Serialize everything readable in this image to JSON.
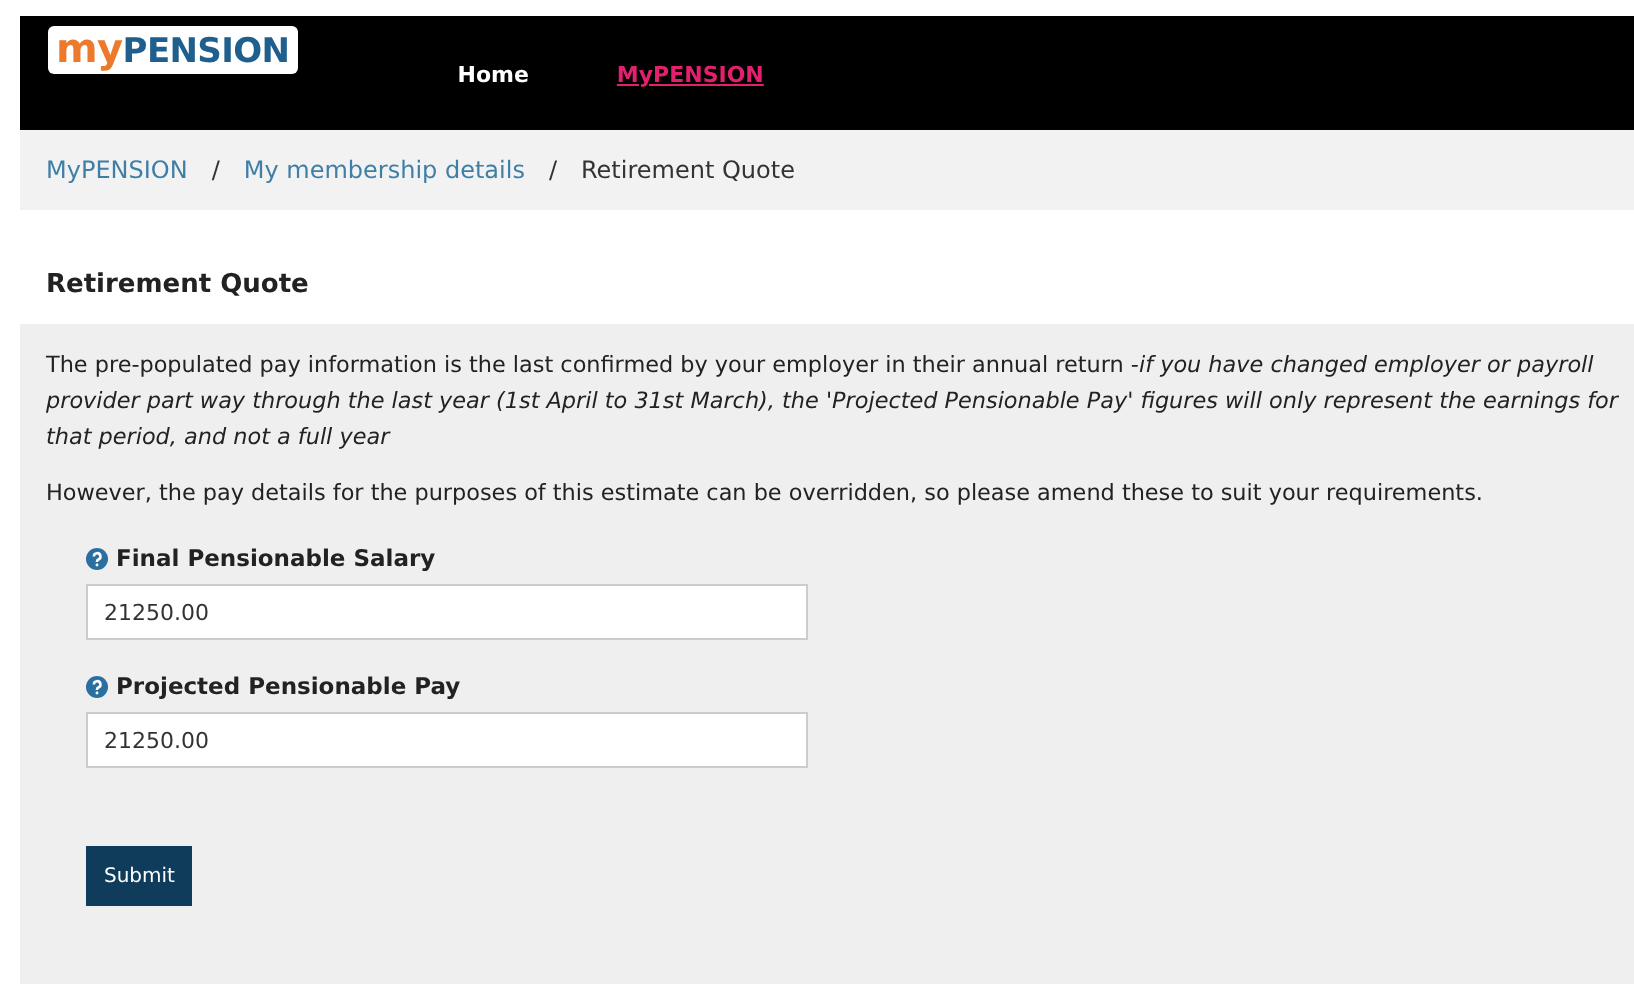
{
  "header": {
    "logo": [
      {
        "text": "my",
        "kind": "accent"
      },
      {
        "text": "PENSION",
        "kind": "main"
      }
    ],
    "nav": [
      {
        "label": "Home",
        "selected": false
      },
      {
        "label": "MyPENSION",
        "selected": true
      }
    ]
  },
  "breadcrumb": [
    {
      "label": "MyPENSION",
      "kind": "link"
    },
    {
      "label": "/",
      "kind": "separator"
    },
    {
      "label": "My membership details",
      "kind": "link"
    },
    {
      "label": "/",
      "kind": "separator"
    },
    {
      "label": "Retirement Quote",
      "kind": "current"
    }
  ],
  "heading": "Retirement Quote",
  "paragraphs": [
    "The pre-populated pay information is the last confirmed by your employer in their annual return -*if you have changed employer or payroll provider part way through the last year (1st April to 31st March), the 'Projected Pensionable Pay' figures will only represent the earnings for that period, and not a full year*",
    "However, the pay details for the purposes of this estimate can be overridden, so please amend these to suit your requirements."
  ],
  "fields": [
    {
      "label": "Final Pensionable Salary",
      "value": "21250.00"
    },
    {
      "label": "Projected Pensionable Pay",
      "value": "21250.00"
    }
  ],
  "submit": "Submit"
}
